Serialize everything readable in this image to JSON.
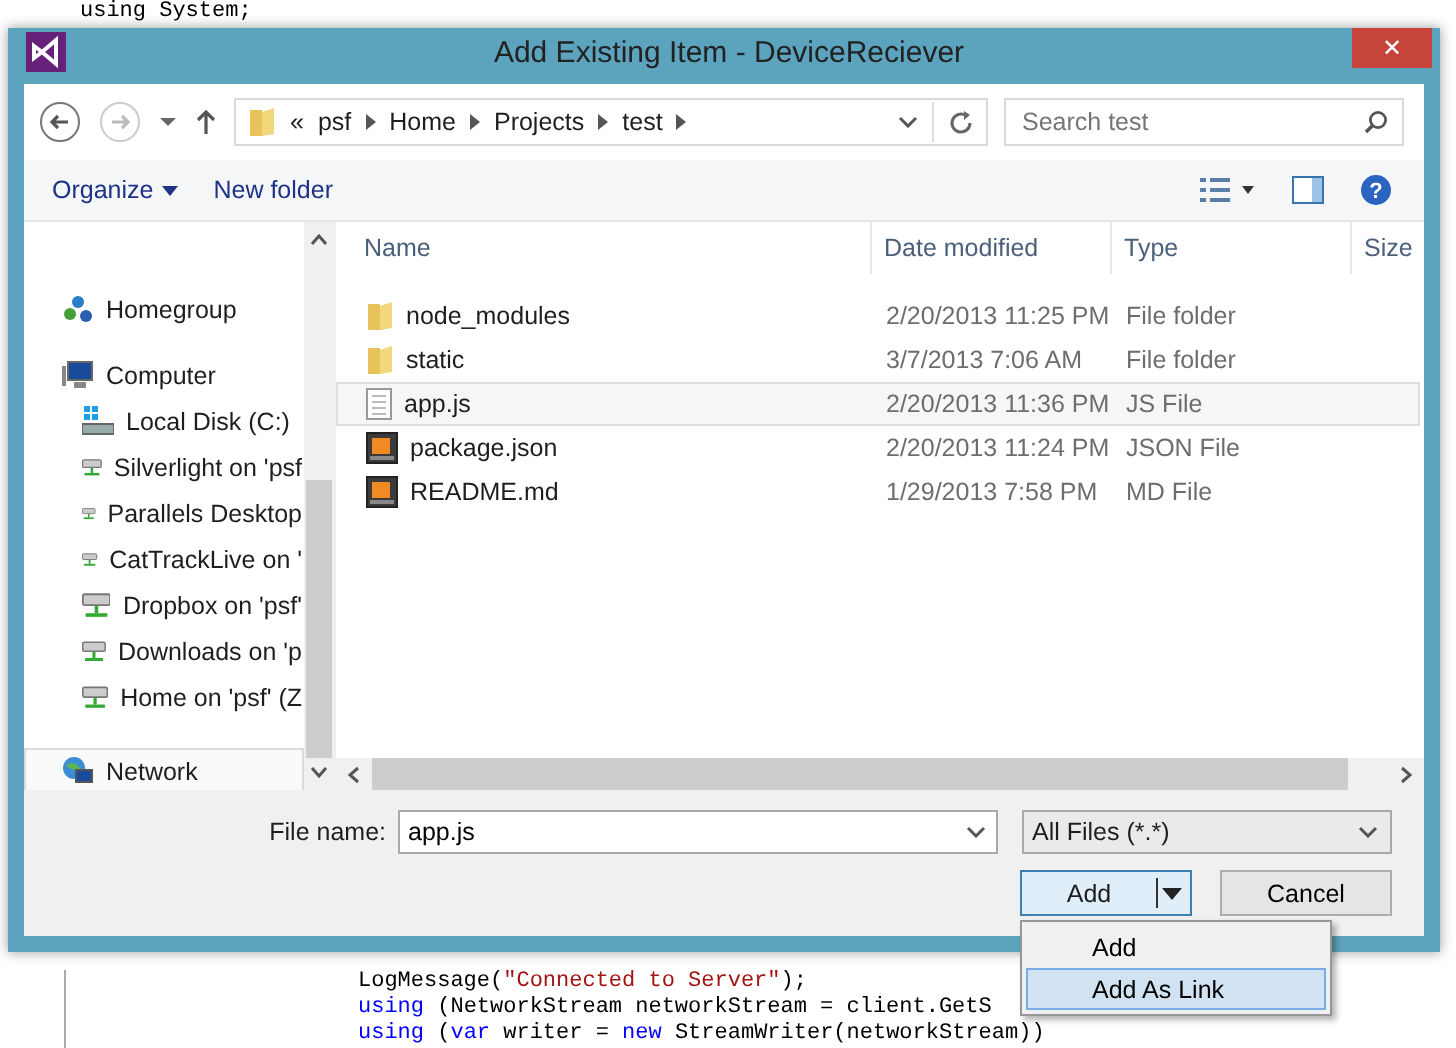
{
  "editor": {
    "top_line": "using System;",
    "bottom_lines": [
      {
        "parts": [
          {
            "text": "LogMessage(",
            "kind": "plain"
          },
          {
            "text": "\"Connected to Server\"",
            "kind": "string"
          },
          {
            "text": ");",
            "kind": "plain"
          }
        ]
      },
      {
        "parts": [
          {
            "text": "using",
            "kind": "keyword"
          },
          {
            "text": " (NetworkStream networkStream = client.GetS",
            "kind": "plain"
          }
        ]
      },
      {
        "parts": [
          {
            "text": "using",
            "kind": "keyword"
          },
          {
            "text": " (",
            "kind": "plain"
          },
          {
            "text": "var",
            "kind": "keyword"
          },
          {
            "text": " writer = ",
            "kind": "plain"
          },
          {
            "text": "new",
            "kind": "keyword"
          },
          {
            "text": " StreamWriter(networkStream))",
            "kind": "plain"
          }
        ]
      }
    ]
  },
  "window": {
    "title": "Add Existing Item - DeviceReciever",
    "close": "✕"
  },
  "address_bar": {
    "overflow": "«",
    "crumbs": [
      "psf",
      "Home",
      "Projects",
      "test"
    ]
  },
  "search": {
    "placeholder": "Search test"
  },
  "toolbar": {
    "organize": "Organize",
    "new_folder": "New folder",
    "help": "?"
  },
  "nav": [
    {
      "label": "Homegroup",
      "kind": "homegroup",
      "selected": false
    },
    {
      "label": "Computer",
      "kind": "computer",
      "selected": false,
      "children": [
        {
          "label": "Local Disk (C:)",
          "kind": "disk",
          "selected": false
        },
        {
          "label": "Silverlight on 'psf",
          "kind": "share",
          "selected": false
        },
        {
          "label": "Parallels Desktop",
          "kind": "share",
          "selected": false
        },
        {
          "label": "CatTrackLive on '",
          "kind": "share",
          "selected": false
        },
        {
          "label": "Dropbox on 'psf'",
          "kind": "share",
          "selected": false
        },
        {
          "label": "Downloads on 'p",
          "kind": "share",
          "selected": false
        },
        {
          "label": "Home on 'psf' (Z",
          "kind": "share",
          "selected": false
        }
      ]
    },
    {
      "label": "Network",
      "kind": "network",
      "selected": true
    }
  ],
  "table": {
    "columns": [
      "Name",
      "Date modified",
      "Type",
      "Size"
    ],
    "rows": [
      {
        "name": "node_modules",
        "kind": "folder",
        "date": "2/20/2013 11:25 PM",
        "type": "File folder",
        "selected": false
      },
      {
        "name": "static",
        "kind": "folder",
        "date": "3/7/2013 7:06 AM",
        "type": "File folder",
        "selected": false
      },
      {
        "name": "app.js",
        "kind": "text",
        "date": "2/20/2013 11:36 PM",
        "type": "JS File",
        "selected": true
      },
      {
        "name": "package.json",
        "kind": "app",
        "date": "2/20/2013 11:24 PM",
        "type": "JSON File",
        "selected": false
      },
      {
        "name": "README.md",
        "kind": "app",
        "date": "1/29/2013 7:58 PM",
        "type": "MD File",
        "selected": false
      }
    ]
  },
  "file_name": {
    "label": "File name:",
    "value": "app.js"
  },
  "filter": {
    "value": "All Files (*.*)"
  },
  "buttons": {
    "add": "Add",
    "cancel": "Cancel"
  },
  "menu": [
    {
      "label": "Add",
      "selected": false
    },
    {
      "label": "Add As Link",
      "selected": true
    }
  ]
}
